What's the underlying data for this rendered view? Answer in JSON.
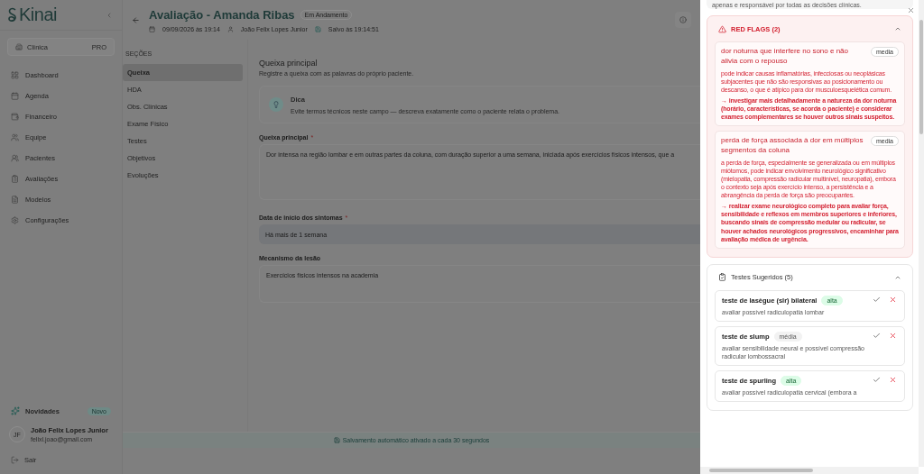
{
  "brand": {
    "logo": "Kinai"
  },
  "sidebar": {
    "plan": {
      "label": "Clínica",
      "badge": "PRO"
    },
    "items": [
      {
        "label": "Dashboard"
      },
      {
        "label": "Agenda"
      },
      {
        "label": "Financeiro"
      },
      {
        "label": "Equipe"
      },
      {
        "label": "Pacientes"
      },
      {
        "label": "Avaliações"
      },
      {
        "label": "Modelos"
      },
      {
        "label": "Configurações"
      }
    ],
    "news": {
      "label": "Novidades",
      "badge": "Novo"
    },
    "user": {
      "initials": "JF",
      "name": "João Felix Lopes Junior",
      "email": "felixl.joao@gmail.com"
    },
    "logout": "Sair"
  },
  "header": {
    "title": "Avaliação - Amanda Ribas",
    "status": "Em Andamento",
    "date": "09/09/2026 às 19:14",
    "author": "João Felix Lopes Junior",
    "saved": "Salvo às 19:14:51"
  },
  "sections": {
    "heading": "SEÇÕES",
    "items": [
      {
        "label": "Queixa",
        "selected": true
      },
      {
        "label": "HDA",
        "selected": false
      },
      {
        "label": "Obs. Clínicas",
        "selected": false
      },
      {
        "label": "Exame Físico",
        "selected": false
      },
      {
        "label": "Testes",
        "selected": false
      },
      {
        "label": "Objetivos",
        "selected": false
      },
      {
        "label": "Evoluções",
        "selected": false
      }
    ]
  },
  "form": {
    "title": "Queixa principal",
    "subtitle": "Registre a queixa com as palavras do próprio paciente.",
    "tip": {
      "title": "Dica",
      "text": "Evite termos técnicos neste campo — descreva exatamente como o paciente relata o problema."
    },
    "fields": [
      {
        "kind": "textarea",
        "label": "Queixa principal",
        "marker": "*",
        "value": "Dor intensa na região lombar e em outras partes da coluna, com duração superior a uma semana, iniciada após exercícios físicos intensos, que a"
      },
      {
        "kind": "select",
        "label": "Data de início dos sintomas",
        "marker": "*",
        "value": "Há mais de 1 semana"
      },
      {
        "kind": "textarea",
        "label": "Mecanismo da lesão",
        "value": "Exercícios físicos intensos na academia"
      }
    ]
  },
  "footer": "Salvamento automático ativado a cada 30 segundos",
  "drawer": {
    "notice": "apenas e responsável por todas as decisões clínicas.",
    "red_flags": {
      "title": "RED FLAGS (2)",
      "expanded": true,
      "items": [
        {
          "title": "dor noturna que interfere no sono e não alivia com o repouso",
          "priority": "media",
          "explanation": "pode indicar causas inflamatórias, infecciosas ou neoplásicas subjacentes que não são responsivas ao posicionamento ou descanso, o que é atípico para dor musculoesquelética comum.",
          "action": "→ investigar mais detalhadamente a natureza da dor noturna (horário, características, se acorda o paciente) e considerar exames complementares se houver outros sinais suspeitos."
        },
        {
          "title": "perda de força associada à dor em múltiplos segmentos da coluna",
          "priority": "media",
          "explanation": "a perda de força, especialmente se generalizada ou em múltiplos miótomos, pode indicar envolvimento neurológico significativo (mielopatia, compressão radicular multinível, neuropatia), embora o contexto seja após exercício intenso, a persistência e a abrangência da perda de força são preocupantes.",
          "action": "→ realizar exame neurológico completo para avaliar força, sensibilidade e reflexos em membros superiores e inferiores, buscando sinais de compressão medular ou radicular, se houver achados neurológicos progressivos, encaminhar para avaliação médica de urgência."
        }
      ]
    },
    "tests": {
      "title": "Testes Sugeridos (5)",
      "expanded": true,
      "items": [
        {
          "name": "teste de lasègue (slr) bilateral",
          "priority": "alta",
          "kind": "high",
          "description": "avaliar possível radiculopatia lombar"
        },
        {
          "name": "teste de slump",
          "priority": "média",
          "kind": "medium",
          "description": "avaliar sensibilidade neural e possível compressão radicular lombossacral"
        },
        {
          "name": "teste de spurling",
          "priority": "alta",
          "kind": "high",
          "description": "avaliar possível radiculopatia cervical (embora a"
        }
      ]
    }
  }
}
